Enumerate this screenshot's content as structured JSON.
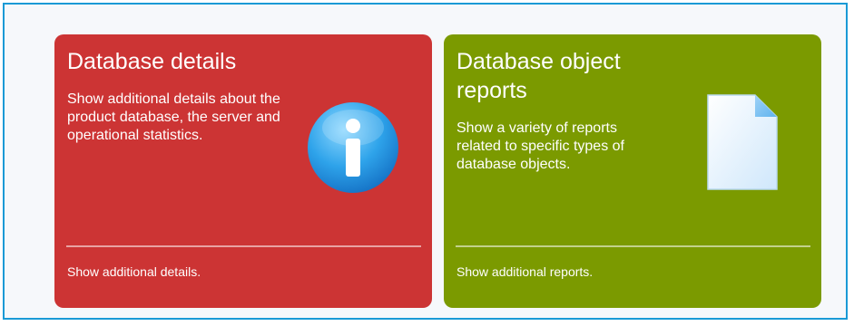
{
  "cards": [
    {
      "title": "Database details",
      "description": "Show additional details about the product database, the server and operational statistics.",
      "link": "Show additional details.",
      "icon": "info-icon",
      "color": "#cc3434"
    },
    {
      "title": "Database object reports",
      "description": "Show a variety of reports related to specific types of database objects.",
      "link": "Show additional reports.",
      "icon": "document-icon",
      "color": "#7b9a00"
    }
  ],
  "theme": {
    "frame_border": "#1a9ad6",
    "background": "#f6f8fb"
  }
}
